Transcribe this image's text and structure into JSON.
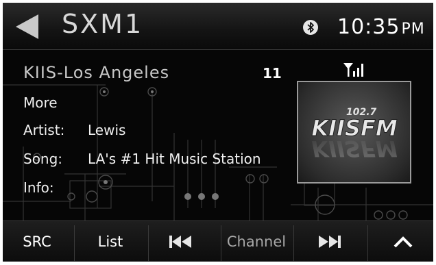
{
  "header": {
    "source": "SXM1",
    "time": "10:35",
    "ampm": "PM"
  },
  "now_playing": {
    "station": "KIIS-Los Angeles",
    "channel_number": "11",
    "more_label": "More",
    "artist_label": "Artist:",
    "artist_value": "Lewis",
    "song_label": "Song:",
    "song_value": "LA's #1 Hit Music Station",
    "info_label": "Info:"
  },
  "album_art": {
    "frequency": "102.7",
    "logo_text": "KIISFM"
  },
  "bottom_bar": {
    "src_label": "SRC",
    "list_label": "List",
    "channel_label": "Channel"
  },
  "icons": [
    "back-arrow-icon",
    "bluetooth-icon",
    "signal-strength-icon",
    "previous-track-icon",
    "next-track-icon",
    "chevron-up-icon"
  ]
}
